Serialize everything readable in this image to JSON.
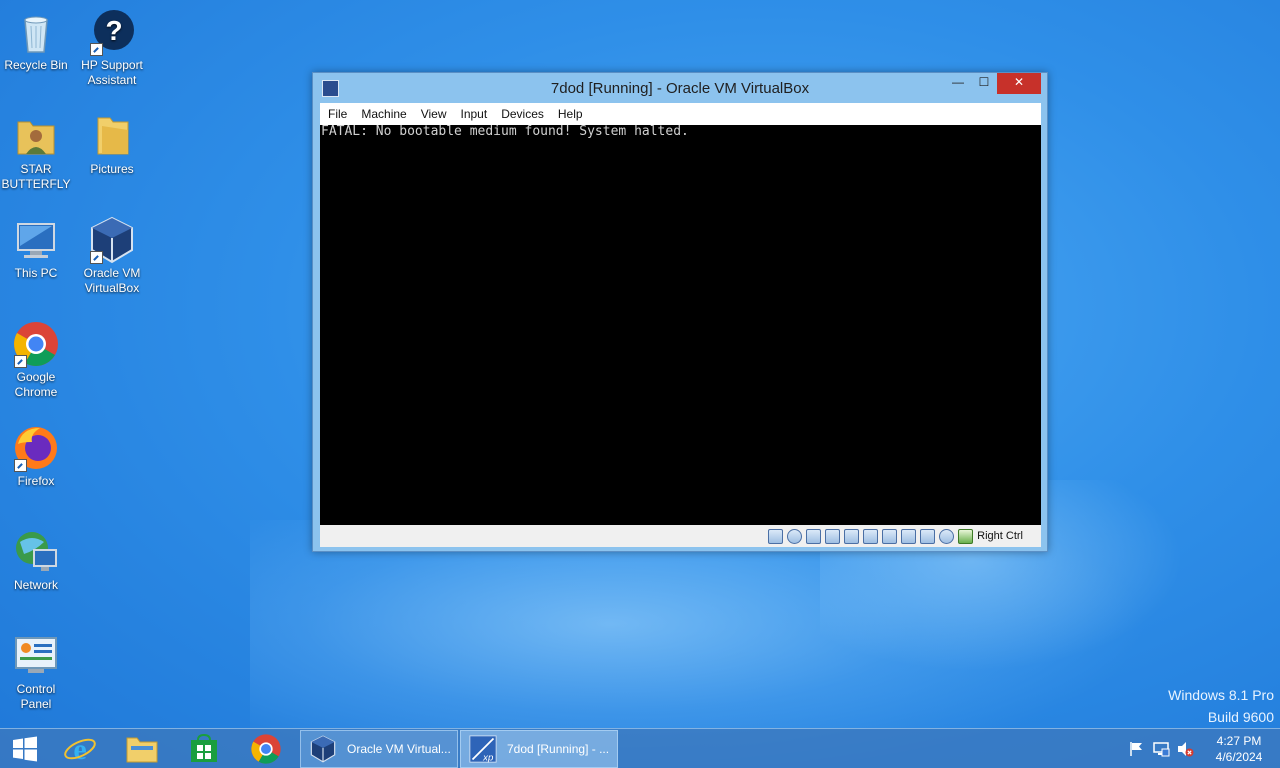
{
  "desktop": {
    "icons": [
      {
        "label": "Recycle Bin"
      },
      {
        "label": "HP Support Assistant"
      },
      {
        "label": "STAR BUTTERFLY"
      },
      {
        "label": "Pictures"
      },
      {
        "label": "This PC"
      },
      {
        "label": "Oracle VM VirtualBox"
      },
      {
        "label": "Google Chrome"
      },
      {
        "label": "Firefox"
      },
      {
        "label": "Network"
      },
      {
        "label": "Control Panel"
      }
    ],
    "watermark": {
      "line1": "Windows 8.1 Pro",
      "line2": "Build 9600"
    }
  },
  "vbox_window": {
    "title": "7dod [Running] - Oracle VM VirtualBox",
    "controls": {
      "minimize": "—",
      "maximize": "☐",
      "close": "✕"
    },
    "menu": [
      "File",
      "Machine",
      "View",
      "Input",
      "Devices",
      "Help"
    ],
    "console_text": "FATAL: No bootable medium found! System halted.",
    "status": {
      "host_key": "Right Ctrl",
      "icons": [
        "hard-disk-icon",
        "optical-drive-icon",
        "audio-icon",
        "network-icon",
        "usb-icon",
        "shared-folders-icon",
        "display-icon",
        "video-capture-icon",
        "cpu-icon",
        "mouse-integration-icon",
        "keyboard-capture-icon"
      ]
    }
  },
  "taskbar": {
    "pinned": [
      "start-button",
      "internet-explorer",
      "file-explorer",
      "store",
      "google-chrome"
    ],
    "tasks": [
      {
        "label": "Oracle VM Virtual..."
      },
      {
        "label": "7dod [Running] - ..."
      }
    ],
    "clock": {
      "time": "4:27 PM",
      "date": "4/6/2024"
    }
  },
  "colors": {
    "desktop_bg": "#2f8fe8",
    "close_button": "#c7312a",
    "window_frame": "#8cc3ee",
    "console_bg": "#000000",
    "console_text": "#d0d0d0"
  }
}
